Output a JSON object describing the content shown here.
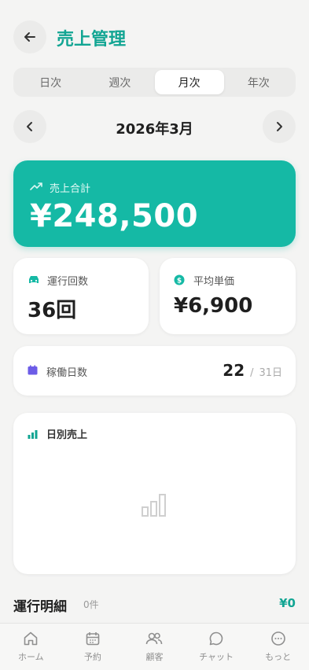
{
  "header": {
    "title": "売上管理"
  },
  "period_tabs": [
    {
      "label": "日次"
    },
    {
      "label": "週次"
    },
    {
      "label": "月次",
      "active": true
    },
    {
      "label": "年次"
    }
  ],
  "month": {
    "label": "2026年3月"
  },
  "total": {
    "label": "売上合計",
    "value": "¥248,500"
  },
  "rides": {
    "label": "運行回数",
    "value": "36回"
  },
  "avg_price": {
    "label": "平均単価",
    "value": "¥6,900"
  },
  "work_days": {
    "label": "稼働日数",
    "value": "22",
    "separator": "/",
    "total": "31日"
  },
  "daily_chart": {
    "title": "日別売上"
  },
  "details": {
    "title": "運行明細",
    "count": "0件",
    "amount": "¥0"
  },
  "tabbar": [
    {
      "label": "ホーム",
      "icon": "home-icon"
    },
    {
      "label": "予約",
      "icon": "calendar-icon"
    },
    {
      "label": "顧客",
      "icon": "users-icon"
    },
    {
      "label": "チャット",
      "icon": "chat-icon"
    },
    {
      "label": "もっと",
      "icon": "more-icon"
    }
  ],
  "colors": {
    "accent": "#15b9a5",
    "accent_text": "#12a593"
  }
}
